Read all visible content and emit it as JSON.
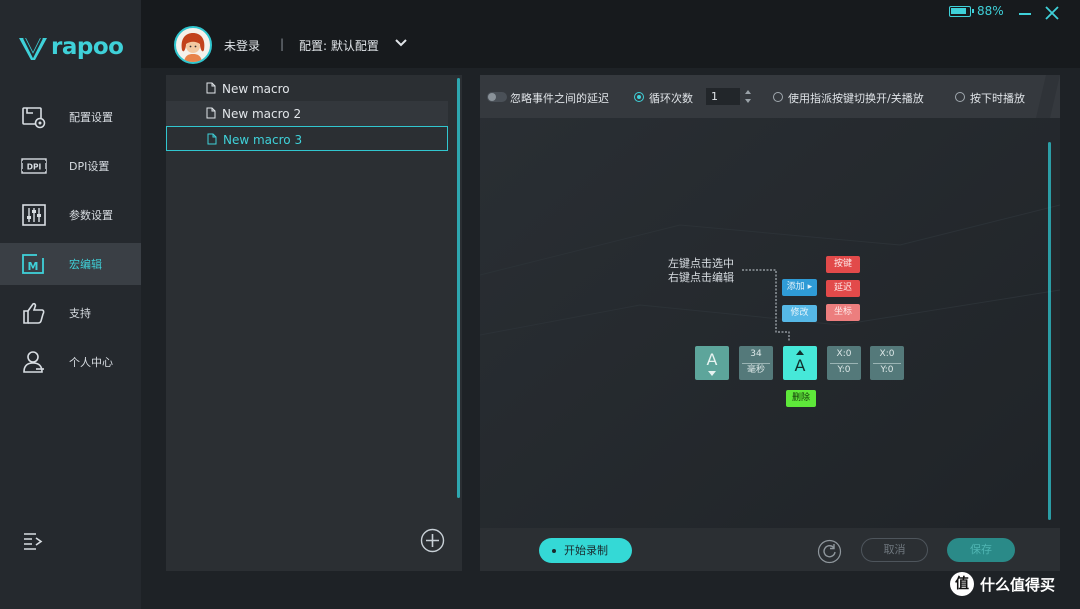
{
  "app": {
    "brand": "rapoo"
  },
  "header": {
    "login_status": "未登录",
    "separator": "|",
    "profile_label": "配置: 默认配置",
    "battery_percent": "88%",
    "battery_level": 0.88
  },
  "sidebar": {
    "items": [
      {
        "label": "配置设置",
        "icon": "config-icon"
      },
      {
        "label": "DPI设置",
        "icon": "dpi-icon"
      },
      {
        "label": "参数设置",
        "icon": "sliders-icon"
      },
      {
        "label": "宏编辑",
        "icon": "macro-icon",
        "active": true
      },
      {
        "label": "支持",
        "icon": "thumbs-up-icon"
      },
      {
        "label": "个人中心",
        "icon": "user-icon"
      }
    ]
  },
  "macros": {
    "items": [
      {
        "name": "New macro"
      },
      {
        "name": "New macro 2"
      },
      {
        "name": "New macro 3",
        "selected": true
      }
    ]
  },
  "toolbar": {
    "ignore_delay": "忽略事件之间的延迟",
    "loop_count_label": "循环次数",
    "loop_count_value": "1",
    "toggle_by_key": "使用指派按键切换开/关播放",
    "play_while_pressed": "按下时播放"
  },
  "diagram": {
    "hint_line1": "左键点击选中",
    "hint_line2": "右键点击编辑",
    "btn_add": "添加",
    "btn_modify": "修改",
    "btn_key": "按键",
    "btn_delay": "延迟",
    "btn_coord": "坐标",
    "btn_delete": "删除",
    "key1": "A",
    "delay_value": "34",
    "delay_unit": "毫秒",
    "key2": "A",
    "coord1_x": "X:0",
    "coord1_y": "Y:0",
    "coord2_x": "X:0",
    "coord2_y": "Y:0"
  },
  "footer": {
    "record": "开始录制",
    "cancel": "取消",
    "save": "保存"
  },
  "watermark": {
    "icon_text": "值",
    "text": "什么值得买"
  },
  "colors": {
    "accent": "#3fd1d9",
    "record": "#34d9d6",
    "red_chip": "#e24a4a",
    "green_chip": "#5ee83a"
  }
}
